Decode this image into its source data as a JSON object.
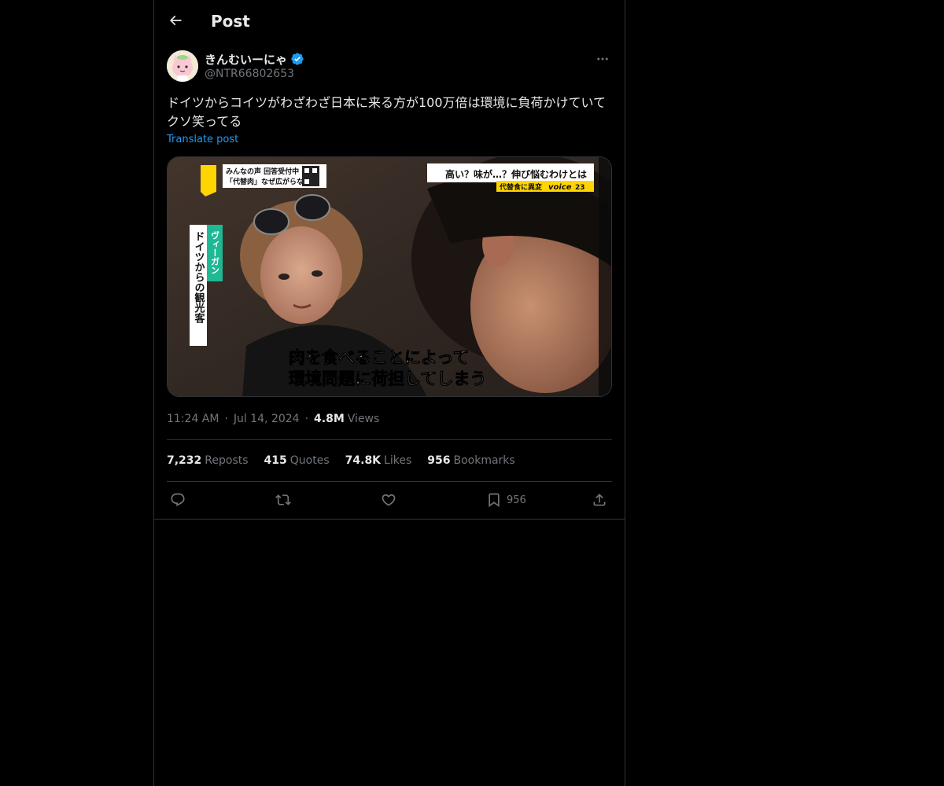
{
  "header": {
    "title": "Post"
  },
  "author": {
    "display_name": "きんむいーにゃ",
    "handle": "@NTR66802653"
  },
  "post": {
    "text": "ドイツからコイツがわざわざ日本に来る方が100万倍は環境に負荷かけていてクソ笑ってる",
    "translate_label": "Translate post"
  },
  "media": {
    "top_left_box_line1": "みんなの声 回答受付中",
    "top_left_box_line2": "「代替肉」なぜ広がらない？",
    "top_right_line1": "高い？味が…？伸び悩むわけとは",
    "top_right_line2": "代替食に異変",
    "top_right_brand": "voice",
    "top_right_brand_num": "23",
    "vertical_tag": "ヴィーガン",
    "vertical_caption": "ドイツからの観光客",
    "subtitle_line1": "肉を食べることによって",
    "subtitle_line2": "環境問題に荷担してしまう"
  },
  "meta": {
    "time": "11:24 AM",
    "date": "Jul 14, 2024",
    "views_count": "4.8M",
    "views_label": "Views"
  },
  "stats": {
    "reposts_count": "7,232",
    "reposts_label": "Reposts",
    "quotes_count": "415",
    "quotes_label": "Quotes",
    "likes_count": "74.8K",
    "likes_label": "Likes",
    "bookmarks_count": "956",
    "bookmarks_label": "Bookmarks"
  },
  "actions": {
    "bookmark_count": "956"
  },
  "colors": {
    "background": "#000000",
    "text_primary": "#e7e9ea",
    "text_secondary": "#71767b",
    "link": "#1d9bf0",
    "border": "#2f3336",
    "verified": "#1d9bf0"
  }
}
